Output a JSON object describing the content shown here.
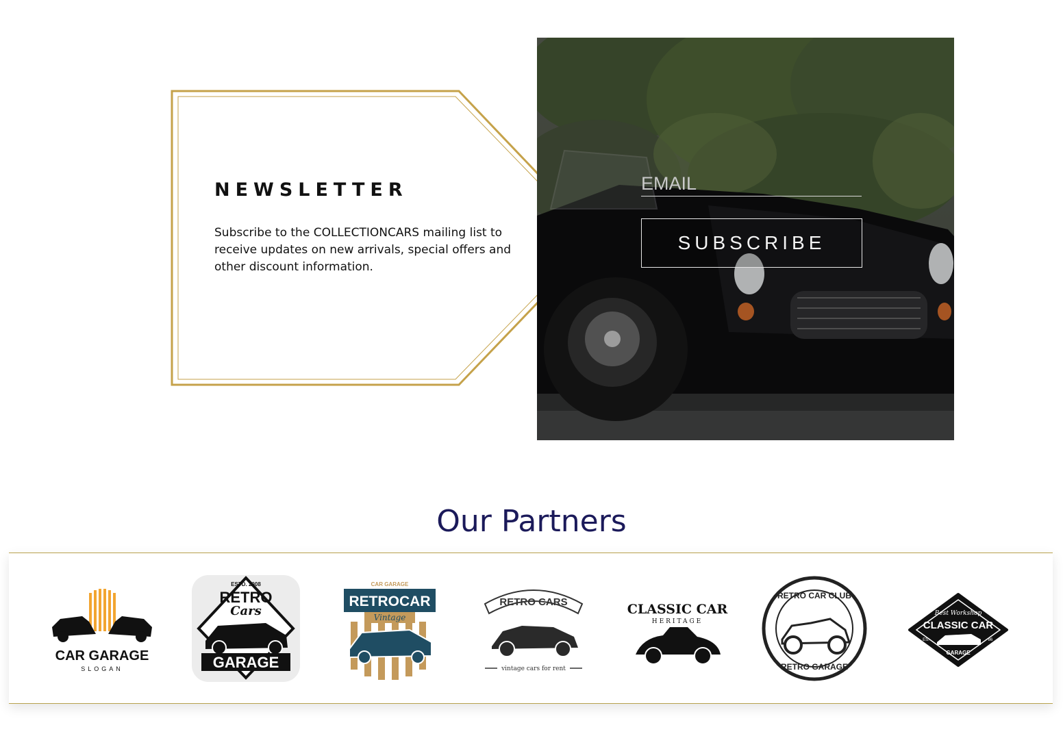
{
  "newsletter": {
    "title": "NEWSLETTER",
    "description": "Subscribe to the COLLECTIONCARS mailing list to receive updates on new arrivals, special offers and other discount information.",
    "email_placeholder": "EMAIL",
    "subscribe_label": "SUBSCRIBE"
  },
  "partners": {
    "title": "Our Partners",
    "logos": [
      {
        "name": "car-garage-logo",
        "line1": "CAR GARAGE",
        "line2": "SLOGAN"
      },
      {
        "name": "retro-cars-garage-logo",
        "estd": "ESTD. 2008",
        "line1": "RETRO",
        "line2": "Cars",
        "line3": "GARAGE"
      },
      {
        "name": "retrocar-vintage-logo",
        "top": "CAR GARAGE",
        "line1": "RETROCAR",
        "line2": "Vintage"
      },
      {
        "name": "retro-cars-rent-logo",
        "line1": "RETRO CARS",
        "line2": "vintage cars for rent"
      },
      {
        "name": "classic-car-heritage-logo",
        "line1": "CLASSIC CAR",
        "line2": "HERITAGE"
      },
      {
        "name": "retro-car-club-logo",
        "line1": "RETRO CAR CLUB",
        "line2": "RETRO GARAGE"
      },
      {
        "name": "classic-car-workshop-logo",
        "top": "Best Workshop",
        "line1": "CLASSIC CAR",
        "line2": "GARAGE",
        "est": "ES.",
        "year": "86"
      }
    ]
  },
  "colors": {
    "gold": "#c5a24a",
    "navy": "#1b1a5a",
    "teal": "#1f4d63"
  }
}
